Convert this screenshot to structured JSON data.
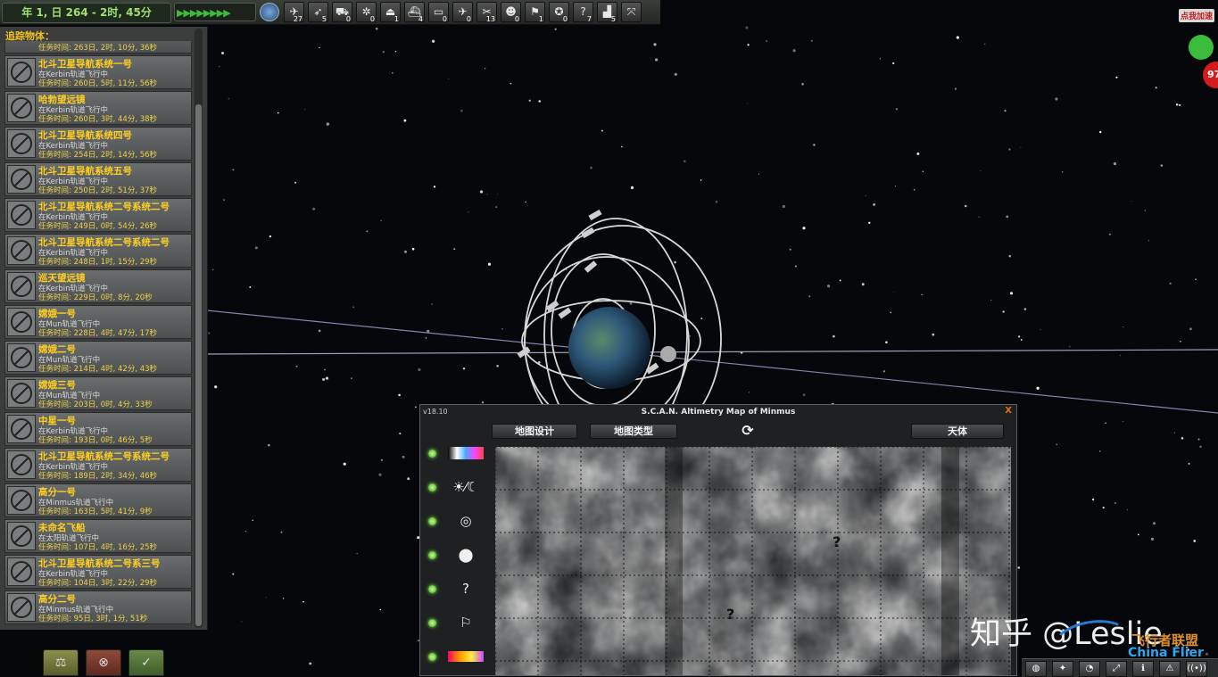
{
  "top_bar": {
    "clock": "年 1, 日 264 - 2时, 45分",
    "warp_arrows": "▶▶▶▶▶▶▶▶",
    "buttons": [
      {
        "icon": "rocket-icon",
        "glyph": "✈",
        "count": "27"
      },
      {
        "icon": "probe-icon",
        "glyph": "➶",
        "count": "5"
      },
      {
        "icon": "rover-icon",
        "glyph": "⛟",
        "count": "0"
      },
      {
        "icon": "station-icon",
        "glyph": "✲",
        "count": "0"
      },
      {
        "icon": "lander-icon",
        "glyph": "⏏",
        "count": "1"
      },
      {
        "icon": "ship-icon",
        "glyph": "⛴",
        "count": "4"
      },
      {
        "icon": "base-icon",
        "glyph": "▭",
        "count": "0"
      },
      {
        "icon": "plane-icon",
        "glyph": "✈",
        "count": "0"
      },
      {
        "icon": "relay-icon",
        "glyph": "✂",
        "count": "13"
      },
      {
        "icon": "eva-icon",
        "glyph": "☻",
        "count": "0"
      },
      {
        "icon": "flag-icon",
        "glyph": "⚑",
        "count": "1"
      },
      {
        "icon": "debris-icon",
        "glyph": "✪",
        "count": "0"
      },
      {
        "icon": "unknown-icon",
        "glyph": "?",
        "count": "7"
      },
      {
        "icon": "building-icon",
        "glyph": "▟",
        "count": "5"
      },
      {
        "icon": "expand-icon",
        "glyph": "⤧",
        "count": ""
      }
    ]
  },
  "tracking": {
    "title": "追踪物体：",
    "partial_first_met": "任务时间: 263日, 2时, 10分, 36秒",
    "items": [
      {
        "name": "北斗卫星导航系统一号",
        "situation": "在Kerbin轨道飞行中",
        "met": "任务时间: 260日, 5时, 11分, 56秒"
      },
      {
        "name": "哈勃望远镜",
        "situation": "在Kerbin轨道飞行中",
        "met": "任务时间: 260日, 3时, 44分, 38秒"
      },
      {
        "name": "北斗卫星导航系统四号",
        "situation": "在Kerbin轨道飞行中",
        "met": "任务时间: 254日, 2时, 14分, 56秒"
      },
      {
        "name": "北斗卫星导航系统五号",
        "situation": "在Kerbin轨道飞行中",
        "met": "任务时间: 250日, 2时, 51分, 37秒"
      },
      {
        "name": "北斗卫星导航系统二号系统二号",
        "situation": "在Kerbin轨道飞行中",
        "met": "任务时间: 249日, 0时, 54分, 26秒"
      },
      {
        "name": "北斗卫星导航系统二号系统二号",
        "situation": "在Kerbin轨道飞行中",
        "met": "任务时间: 248日, 1时, 15分, 29秒"
      },
      {
        "name": "巡天望远镜",
        "situation": "在Kerbin轨道飞行中",
        "met": "任务时间: 229日, 0时, 8分, 20秒"
      },
      {
        "name": "嫦娥一号",
        "situation": "在Mun轨道飞行中",
        "met": "任务时间: 228日, 4时, 47分, 17秒"
      },
      {
        "name": "嫦娥二号",
        "situation": "在Mun轨道飞行中",
        "met": "任务时间: 214日, 4时, 42分, 43秒"
      },
      {
        "name": "嫦娥三号",
        "situation": "在Mun轨道飞行中",
        "met": "任务时间: 203日, 0时, 4分, 33秒"
      },
      {
        "name": "中星一号",
        "situation": "在Kerbin轨道飞行中",
        "met": "任务时间: 193日, 0时, 46分, 5秒"
      },
      {
        "name": "北斗卫星导航系统二号系统二号",
        "situation": "在Kerbin轨道飞行中",
        "met": "任务时间: 189日, 2时, 34分, 46秒"
      },
      {
        "name": "高分一号",
        "situation": "在Minmus轨道飞行中",
        "met": "任务时间: 163日, 5时, 41分, 9秒"
      },
      {
        "name": "未命名飞船",
        "situation": "在太阳轨道飞行中",
        "met": "任务时间: 107日, 4时, 16分, 25秒"
      },
      {
        "name": "北斗卫星导航系统二号系三号",
        "situation": "在Kerbin轨道飞行中",
        "met": "任务时间: 104日, 3时, 22分, 29秒"
      },
      {
        "name": "高分二号",
        "situation": "在Minmus轨道飞行中",
        "met": "任务时间: 95日, 3时, 1分, 51秒"
      }
    ],
    "bottom_buttons": [
      {
        "icon": "fly-icon",
        "glyph": "⚖"
      },
      {
        "icon": "terminate-icon",
        "glyph": "⊗"
      },
      {
        "icon": "recover-icon",
        "glyph": "✓"
      }
    ]
  },
  "scan": {
    "version": "v18.10",
    "title": "S.C.A.N. Altimetry Map of Minmus",
    "close": "X",
    "buttons": {
      "map_design": "地图设计",
      "map_type": "地图类型",
      "body": "天体"
    },
    "refresh_glyph": "⟳",
    "toggles": [
      {
        "icon": "color-ramp-icon",
        "glyph": ""
      },
      {
        "icon": "day-night-icon",
        "glyph": "☀⁄☾"
      },
      {
        "icon": "grid-icon",
        "glyph": "◎"
      },
      {
        "icon": "waypoint-icon",
        "glyph": "⬤"
      },
      {
        "icon": "anomaly-icon",
        "glyph": "?"
      },
      {
        "icon": "flag-icon",
        "glyph": "⚐"
      },
      {
        "icon": "biome-ramp-icon",
        "glyph": ""
      }
    ]
  },
  "overlay": {
    "corner_label": "点我加速",
    "corner_number": "97",
    "watermark": "知乎 @Leslie",
    "logo_cn": "飞行者联盟",
    "logo_en": "China Flier"
  },
  "bottom_toolbar": [
    {
      "icon": "globe-icon",
      "glyph": "◍"
    },
    {
      "icon": "scansat-icon",
      "glyph": "✦"
    },
    {
      "icon": "kac-icon",
      "glyph": "◔"
    },
    {
      "icon": "maneuver-icon",
      "glyph": "⤢"
    },
    {
      "icon": "info-icon",
      "glyph": "ℹ"
    },
    {
      "icon": "warning-icon",
      "glyph": "⚠"
    },
    {
      "icon": "antenna-icon",
      "glyph": "((•))"
    }
  ],
  "colors": {
    "accent_yellow": "#ffd020",
    "green_dot": "#7f3",
    "orange": "#e07010"
  }
}
